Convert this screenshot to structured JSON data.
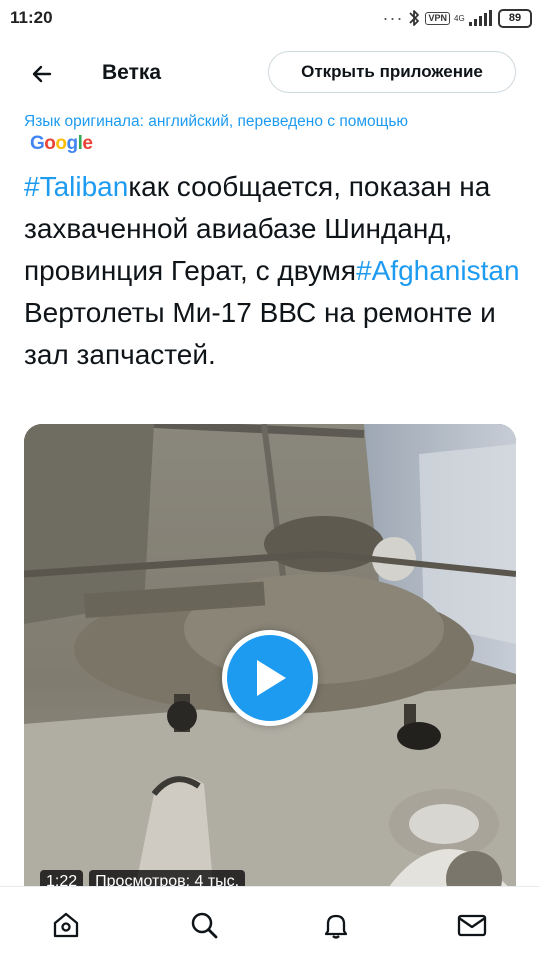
{
  "status_bar": {
    "time": "11:20",
    "overflow_dots": "···",
    "vpn": "VPN",
    "network": "4G",
    "battery": "89"
  },
  "header": {
    "back_icon": "arrow-left-icon",
    "title": "Ветка",
    "open_app": "Открыть приложение"
  },
  "translation": {
    "note": "Язык оригинала: английский, переведено с помощью",
    "provider": [
      "G",
      "o",
      "o",
      "g",
      "l",
      "e"
    ],
    "provider_colors": [
      "#4285f4",
      "#ea4335",
      "#fbbc05",
      "#4285f4",
      "#34a853",
      "#ea4335"
    ]
  },
  "tweet": {
    "hashtag1": "#Taliban",
    "text1": "как сообщается, показан на захваченной авиабазе Шинданд, провинция Герат, с двумя",
    "hashtag2": "#Afghanistan",
    "text2": "\nВертолеты Ми-17 ВВС на ремонте и зал запчастей."
  },
  "media": {
    "duration": "1:22",
    "views": "Просмотров: 4 тыс.",
    "play_icon": "play-icon"
  },
  "bottom_nav": {
    "items": [
      "home-icon",
      "search-icon",
      "notifications-bell-icon",
      "messages-envelope-icon"
    ]
  },
  "colors": {
    "accent": "#1d9bf0",
    "text": "#0f1419",
    "border": "#cfd9de"
  }
}
